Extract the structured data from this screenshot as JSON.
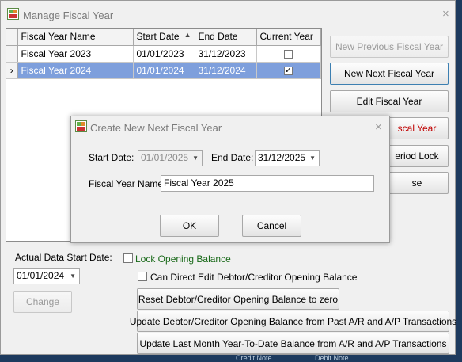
{
  "main_window": {
    "title": "Manage Fiscal Year",
    "close_glyph": "×",
    "icon": "app-icon"
  },
  "grid": {
    "columns": [
      "Fiscal Year Name",
      "Start Date",
      "End Date",
      "Current Year"
    ],
    "sort_glyph": "▲",
    "rows": [
      {
        "name": "Fiscal Year 2023",
        "start": "01/01/2023",
        "end": "31/12/2023",
        "current": false,
        "indicator": ""
      },
      {
        "name": "Fiscal Year 2024",
        "start": "01/01/2024",
        "end": "31/12/2024",
        "current": true,
        "indicator": "›"
      }
    ],
    "check_glyph": "✓"
  },
  "buttons": {
    "new_previous": "New Previous Fiscal Year",
    "new_next": "New Next Fiscal Year",
    "edit": "Edit Fiscal Year",
    "partial_4": "scal Year",
    "partial_5": "eriod Lock",
    "partial_6": "se",
    "change": "Change",
    "reset_opening": "Reset Debtor/Creditor Opening Balance to zero",
    "update_opening": "Update Debtor/Creditor Opening Balance from Past A/R and A/P Transactions",
    "update_ytd": "Update Last Month Year-To-Date Balance from A/R and A/P Transactions"
  },
  "actual_start": {
    "label": "Actual Data Start Date:",
    "value": "01/01/2024"
  },
  "lock_opening": {
    "label": "Lock Opening Balance",
    "checked": false
  },
  "direct_edit": {
    "label": "Can Direct Edit Debtor/Creditor Opening Balance",
    "checked": false
  },
  "dialog": {
    "title": "Create New Next Fiscal Year",
    "close_glyph": "×",
    "start_label": "Start Date:",
    "start_value": "01/01/2025",
    "end_label": "End Date:",
    "end_value": "31/12/2025",
    "name_label": "Fiscal Year Name:",
    "name_value": "Fiscal Year 2025",
    "ok": "OK",
    "cancel": "Cancel"
  },
  "dropdown_glyph": "▼",
  "background_strip": {
    "left_text": "Credit Note",
    "right_text": "Debit Note"
  },
  "colors": {
    "selection": "#7e9fdc",
    "lock_label": "#1a6a1a",
    "partial_red": "#c00000"
  }
}
